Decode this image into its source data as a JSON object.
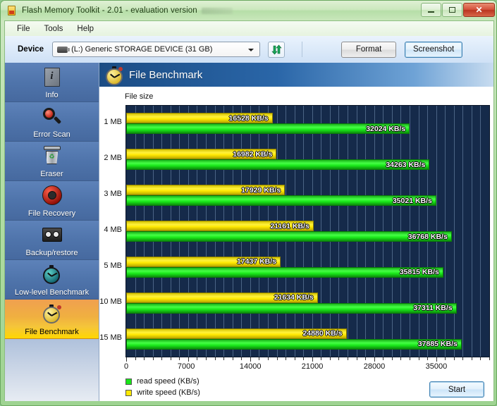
{
  "window": {
    "title": "Flash Memory Toolkit - 2.01 - evaluation version",
    "minimize_label": "",
    "maximize_label": "",
    "close_label": "✕"
  },
  "menu": {
    "items": [
      "File",
      "Tools",
      "Help"
    ]
  },
  "toolbar": {
    "device_label": "Device",
    "device_value": "(L:) Generic STORAGE DEVICE (31 GB)",
    "format_label": "Format",
    "screenshot_label": "Screenshot"
  },
  "sidebar": {
    "items": [
      {
        "label": "Info",
        "icon": "document-info-icon",
        "active": false
      },
      {
        "label": "Error Scan",
        "icon": "magnifier-icon",
        "active": false
      },
      {
        "label": "Eraser",
        "icon": "trash-bin-icon",
        "active": false
      },
      {
        "label": "File Recovery",
        "icon": "lifering-icon",
        "active": false
      },
      {
        "label": "Backup/restore",
        "icon": "tape-cassette-icon",
        "active": false
      },
      {
        "label": "Low-level Benchmark",
        "icon": "stopwatch-icon",
        "active": false
      },
      {
        "label": "File Benchmark",
        "icon": "stopwatch-gold-icon",
        "active": true
      }
    ]
  },
  "panel": {
    "title": "File Benchmark",
    "icon": "stopwatch-gold-icon",
    "start_label": "Start"
  },
  "chart_data": {
    "type": "bar",
    "orientation": "horizontal",
    "title": "",
    "xlabel": "",
    "ylabel": "File size",
    "categories": [
      "1 MB",
      "2 MB",
      "3 MB",
      "4 MB",
      "5 MB",
      "10 MB",
      "15 MB"
    ],
    "series": [
      {
        "name": "write speed (KB/s)",
        "color": "#ffe800",
        "values": [
          16528,
          16982,
          17929,
          21161,
          17437,
          21634,
          24880
        ],
        "labels": [
          "16528 KB/s",
          "16982 KB/s",
          "17929 KB/s",
          "21161 KB/s",
          "17437 KB/s",
          "21634 KB/s",
          "24880 KB/s"
        ]
      },
      {
        "name": "read speed (KB/s)",
        "color": "#19e619",
        "values": [
          32024,
          34263,
          35021,
          36768,
          35815,
          37311,
          37885
        ],
        "labels": [
          "32024 KB/s",
          "34263 KB/s",
          "35021 KB/s",
          "36768 KB/s",
          "35815 KB/s",
          "37311 KB/s",
          "37885 KB/s"
        ]
      }
    ],
    "xticks": [
      0,
      7000,
      14000,
      21000,
      28000,
      35000
    ],
    "xticklabels": [
      "0",
      "7000",
      "14000",
      "21000",
      "28000",
      "35000"
    ],
    "xlim": [
      0,
      41000
    ],
    "grid": true,
    "legend_position": "bottom-left",
    "legend": [
      "read speed (KB/s)",
      "write speed (KB/s)"
    ],
    "plot_background": "#152a4a"
  }
}
